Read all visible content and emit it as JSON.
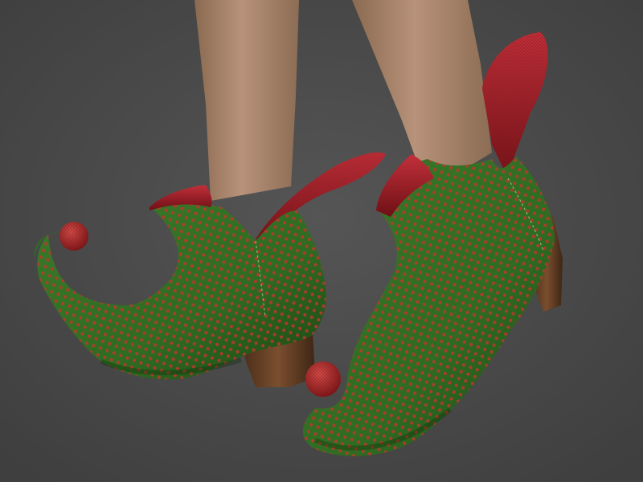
{
  "scene": {
    "subject": "elf-boots",
    "colors": {
      "background": "#4a4a4a",
      "boot_green": "#2f6b22",
      "boot_green_dark": "#1f4a16",
      "dot_red": "#c0362c",
      "lining_red": "#b3222a",
      "lining_red_dark": "#7a1218",
      "heel_brown": "#6b4226",
      "heel_brown_dark": "#3e2615",
      "skin": "#b08a6a",
      "skin_shadow": "#8a6a50",
      "pompom_red": "#b82a2a"
    },
    "icons": [
      "boot-left",
      "boot-right",
      "pompom-left",
      "pompom-right",
      "leg-left",
      "leg-right"
    ]
  }
}
